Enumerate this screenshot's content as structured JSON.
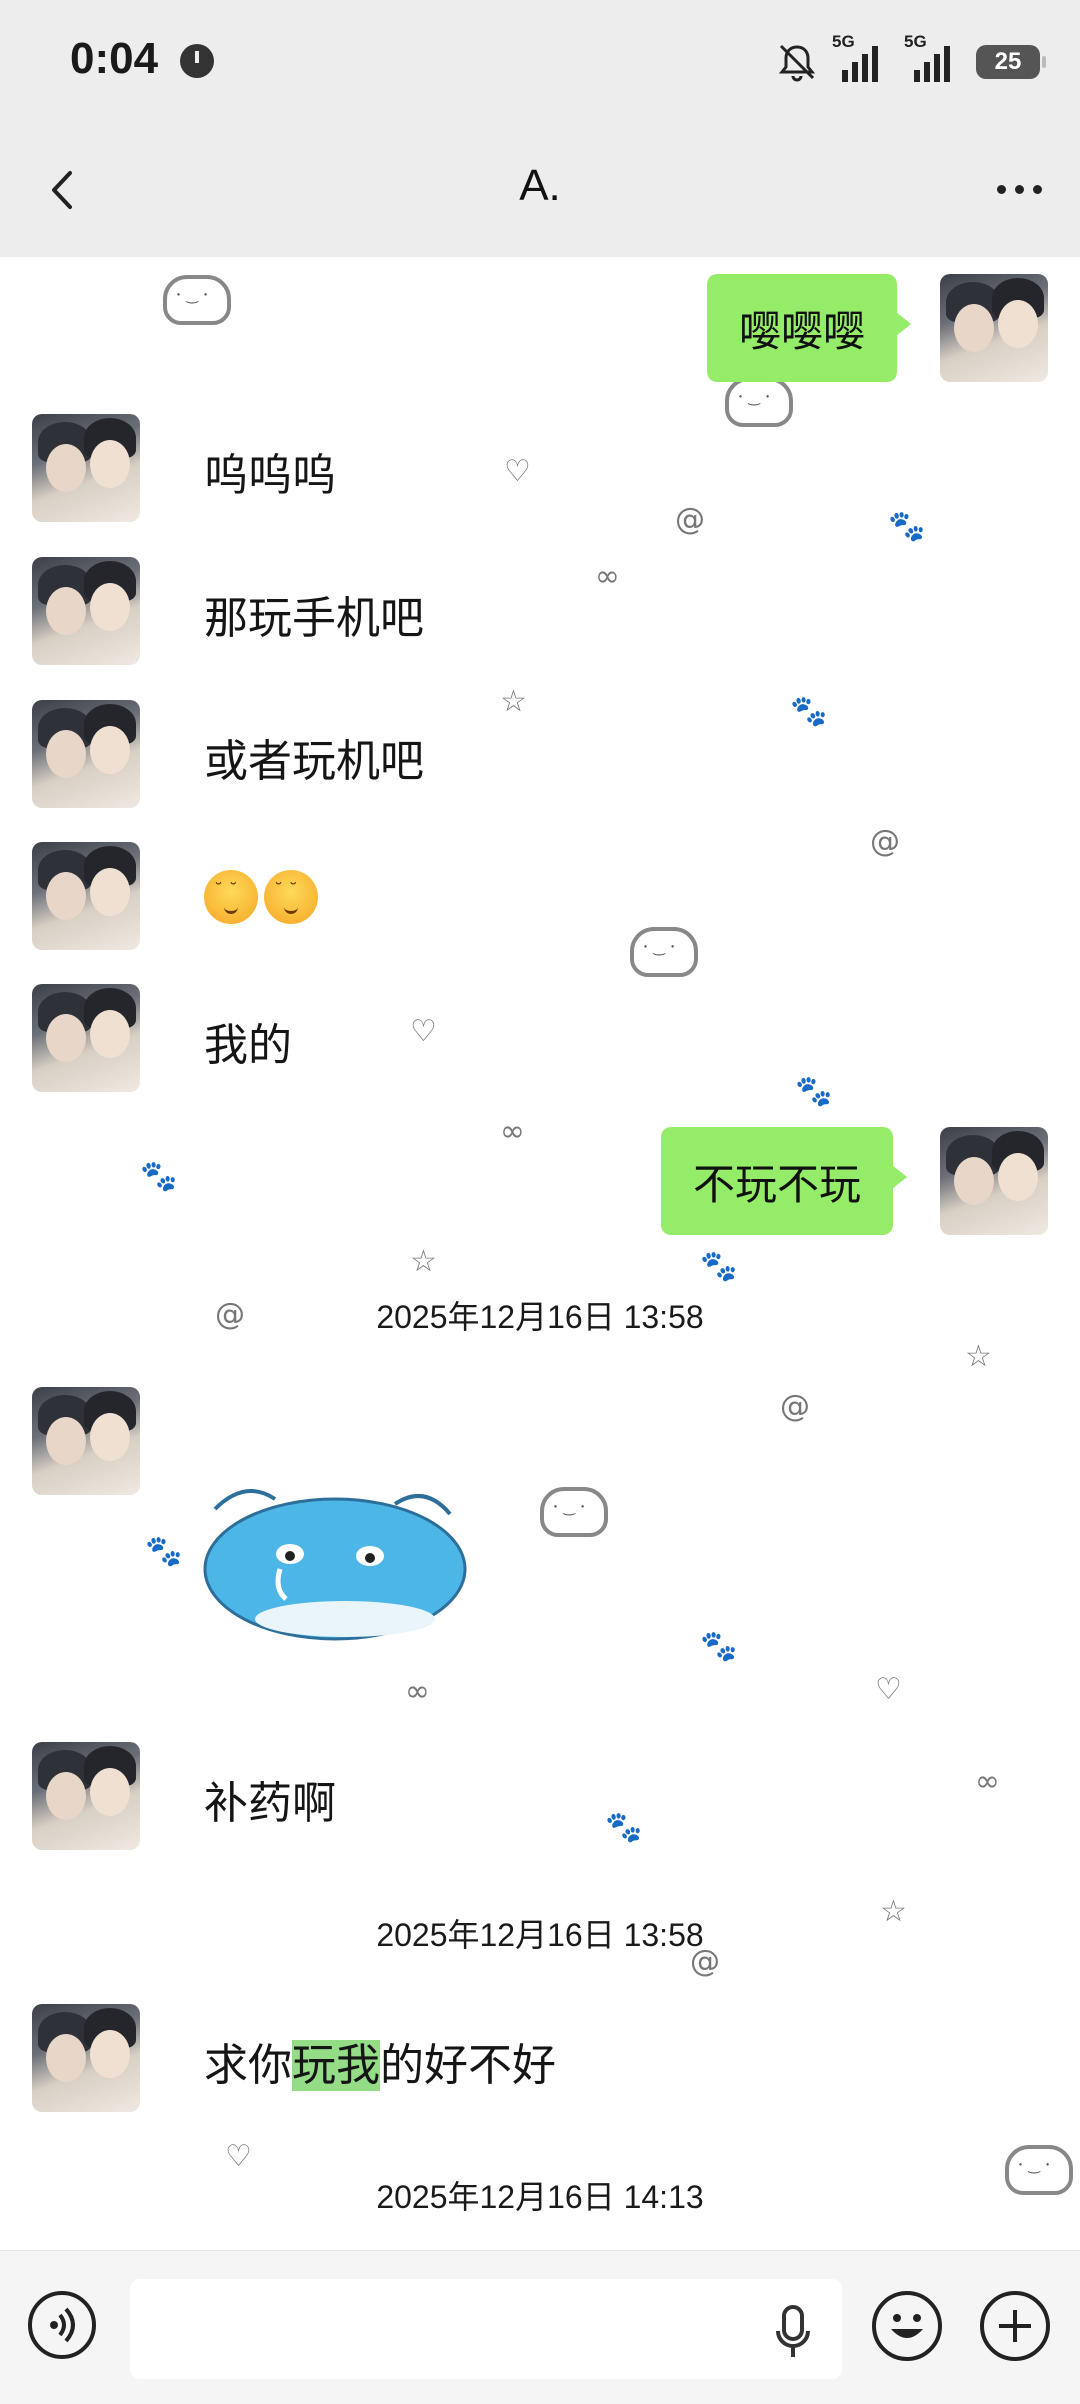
{
  "status_bar": {
    "time": "0:04",
    "signal1": "5G",
    "signal2": "5G",
    "battery": "25"
  },
  "header": {
    "title": "A."
  },
  "messages": [
    {
      "side": "me",
      "text": "嘤嘤嘤"
    },
    {
      "side": "them",
      "text": "呜呜呜"
    },
    {
      "side": "them",
      "text": "那玩手机吧"
    },
    {
      "side": "them",
      "text": "或者玩机吧"
    },
    {
      "side": "them",
      "type": "emoji",
      "emoji": [
        "sleepy-smile-emoji",
        "sleepy-smile-emoji"
      ]
    },
    {
      "side": "them",
      "text": "我的"
    },
    {
      "side": "me",
      "text": "不玩不玩"
    },
    {
      "type": "timestamp",
      "text": "2025年12月16日 13:58"
    },
    {
      "side": "them",
      "type": "sticker",
      "sticker": "crying-blue-hamster-sticker"
    },
    {
      "side": "them",
      "text": "补药啊"
    },
    {
      "type": "timestamp",
      "text": "2025年12月16日 13:58"
    },
    {
      "side": "them",
      "text_parts": [
        "求你",
        "玩我",
        "的好不好"
      ],
      "highlight": "玩我"
    },
    {
      "type": "timestamp",
      "text": "2025年12月16日 14:13"
    }
  ],
  "input_bar": {
    "placeholder": "",
    "icons": [
      "voice-icon",
      "mic-icon",
      "emoji-icon",
      "plus-icon"
    ]
  },
  "colors": {
    "my_bubble": "#95ec69",
    "highlight": "#95dc87",
    "bar_bg": "#ededed"
  }
}
